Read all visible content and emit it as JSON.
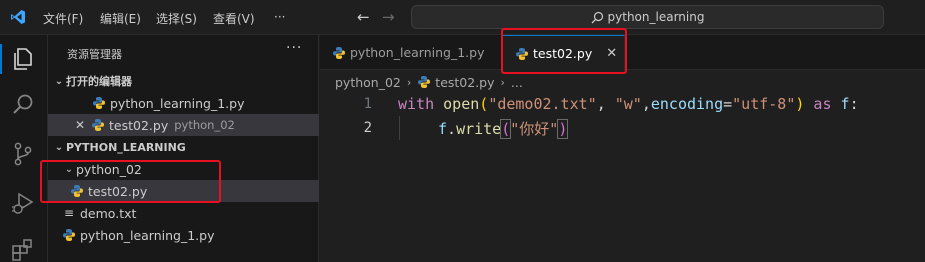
{
  "menu": [
    "文件(F)",
    "编辑(E)",
    "选择(S)",
    "查看(V)",
    "···"
  ],
  "search": {
    "text": "python_learning"
  },
  "sidebar": {
    "title": "资源管理器",
    "more": "···",
    "open_editors_label": "打开的编辑器",
    "open_editors": [
      {
        "name": "python_learning_1.py",
        "desc": ""
      },
      {
        "name": "test02.py",
        "desc": "python_02"
      }
    ],
    "workspace_label": "PYTHON_LEARNING",
    "folder": "python_02",
    "folder_file": "test02.py",
    "files": [
      "demo.txt",
      "python_learning_1.py"
    ]
  },
  "tabs": [
    {
      "label": "python_learning_1.py",
      "active": false
    },
    {
      "label": "test02.py",
      "active": true,
      "close": "✕"
    }
  ],
  "breadcrumb": [
    "python_02",
    "test02.py",
    "..."
  ],
  "code": {
    "line_numbers": [
      "1",
      "2"
    ],
    "line1": {
      "kw1": "with",
      "fn": "open",
      "p1": "(",
      "s1": "\"demo02.txt\"",
      "c1": ", ",
      "s2": "\"w\"",
      "c2": ",",
      "param": "encoding",
      "eq": "=",
      "s3": "\"utf-8\"",
      "p2": ")",
      "kw2": " as ",
      "var": "f",
      "colon": ":"
    },
    "line2": {
      "var": "f",
      "dot": ".",
      "fn": "write",
      "p1": "(",
      "s1": "\"你好\"",
      "p2": ")"
    }
  },
  "colors": {
    "accent": "#0078d4",
    "highlight": "#e81123",
    "python_blue": "#3d7ab8",
    "python_yellow": "#f1c232"
  },
  "icons": [
    "vscode-logo-icon",
    "explorer-icon",
    "search-icon",
    "source-control-icon",
    "run-debug-icon",
    "extensions-icon",
    "python-file-icon",
    "text-file-icon"
  ]
}
